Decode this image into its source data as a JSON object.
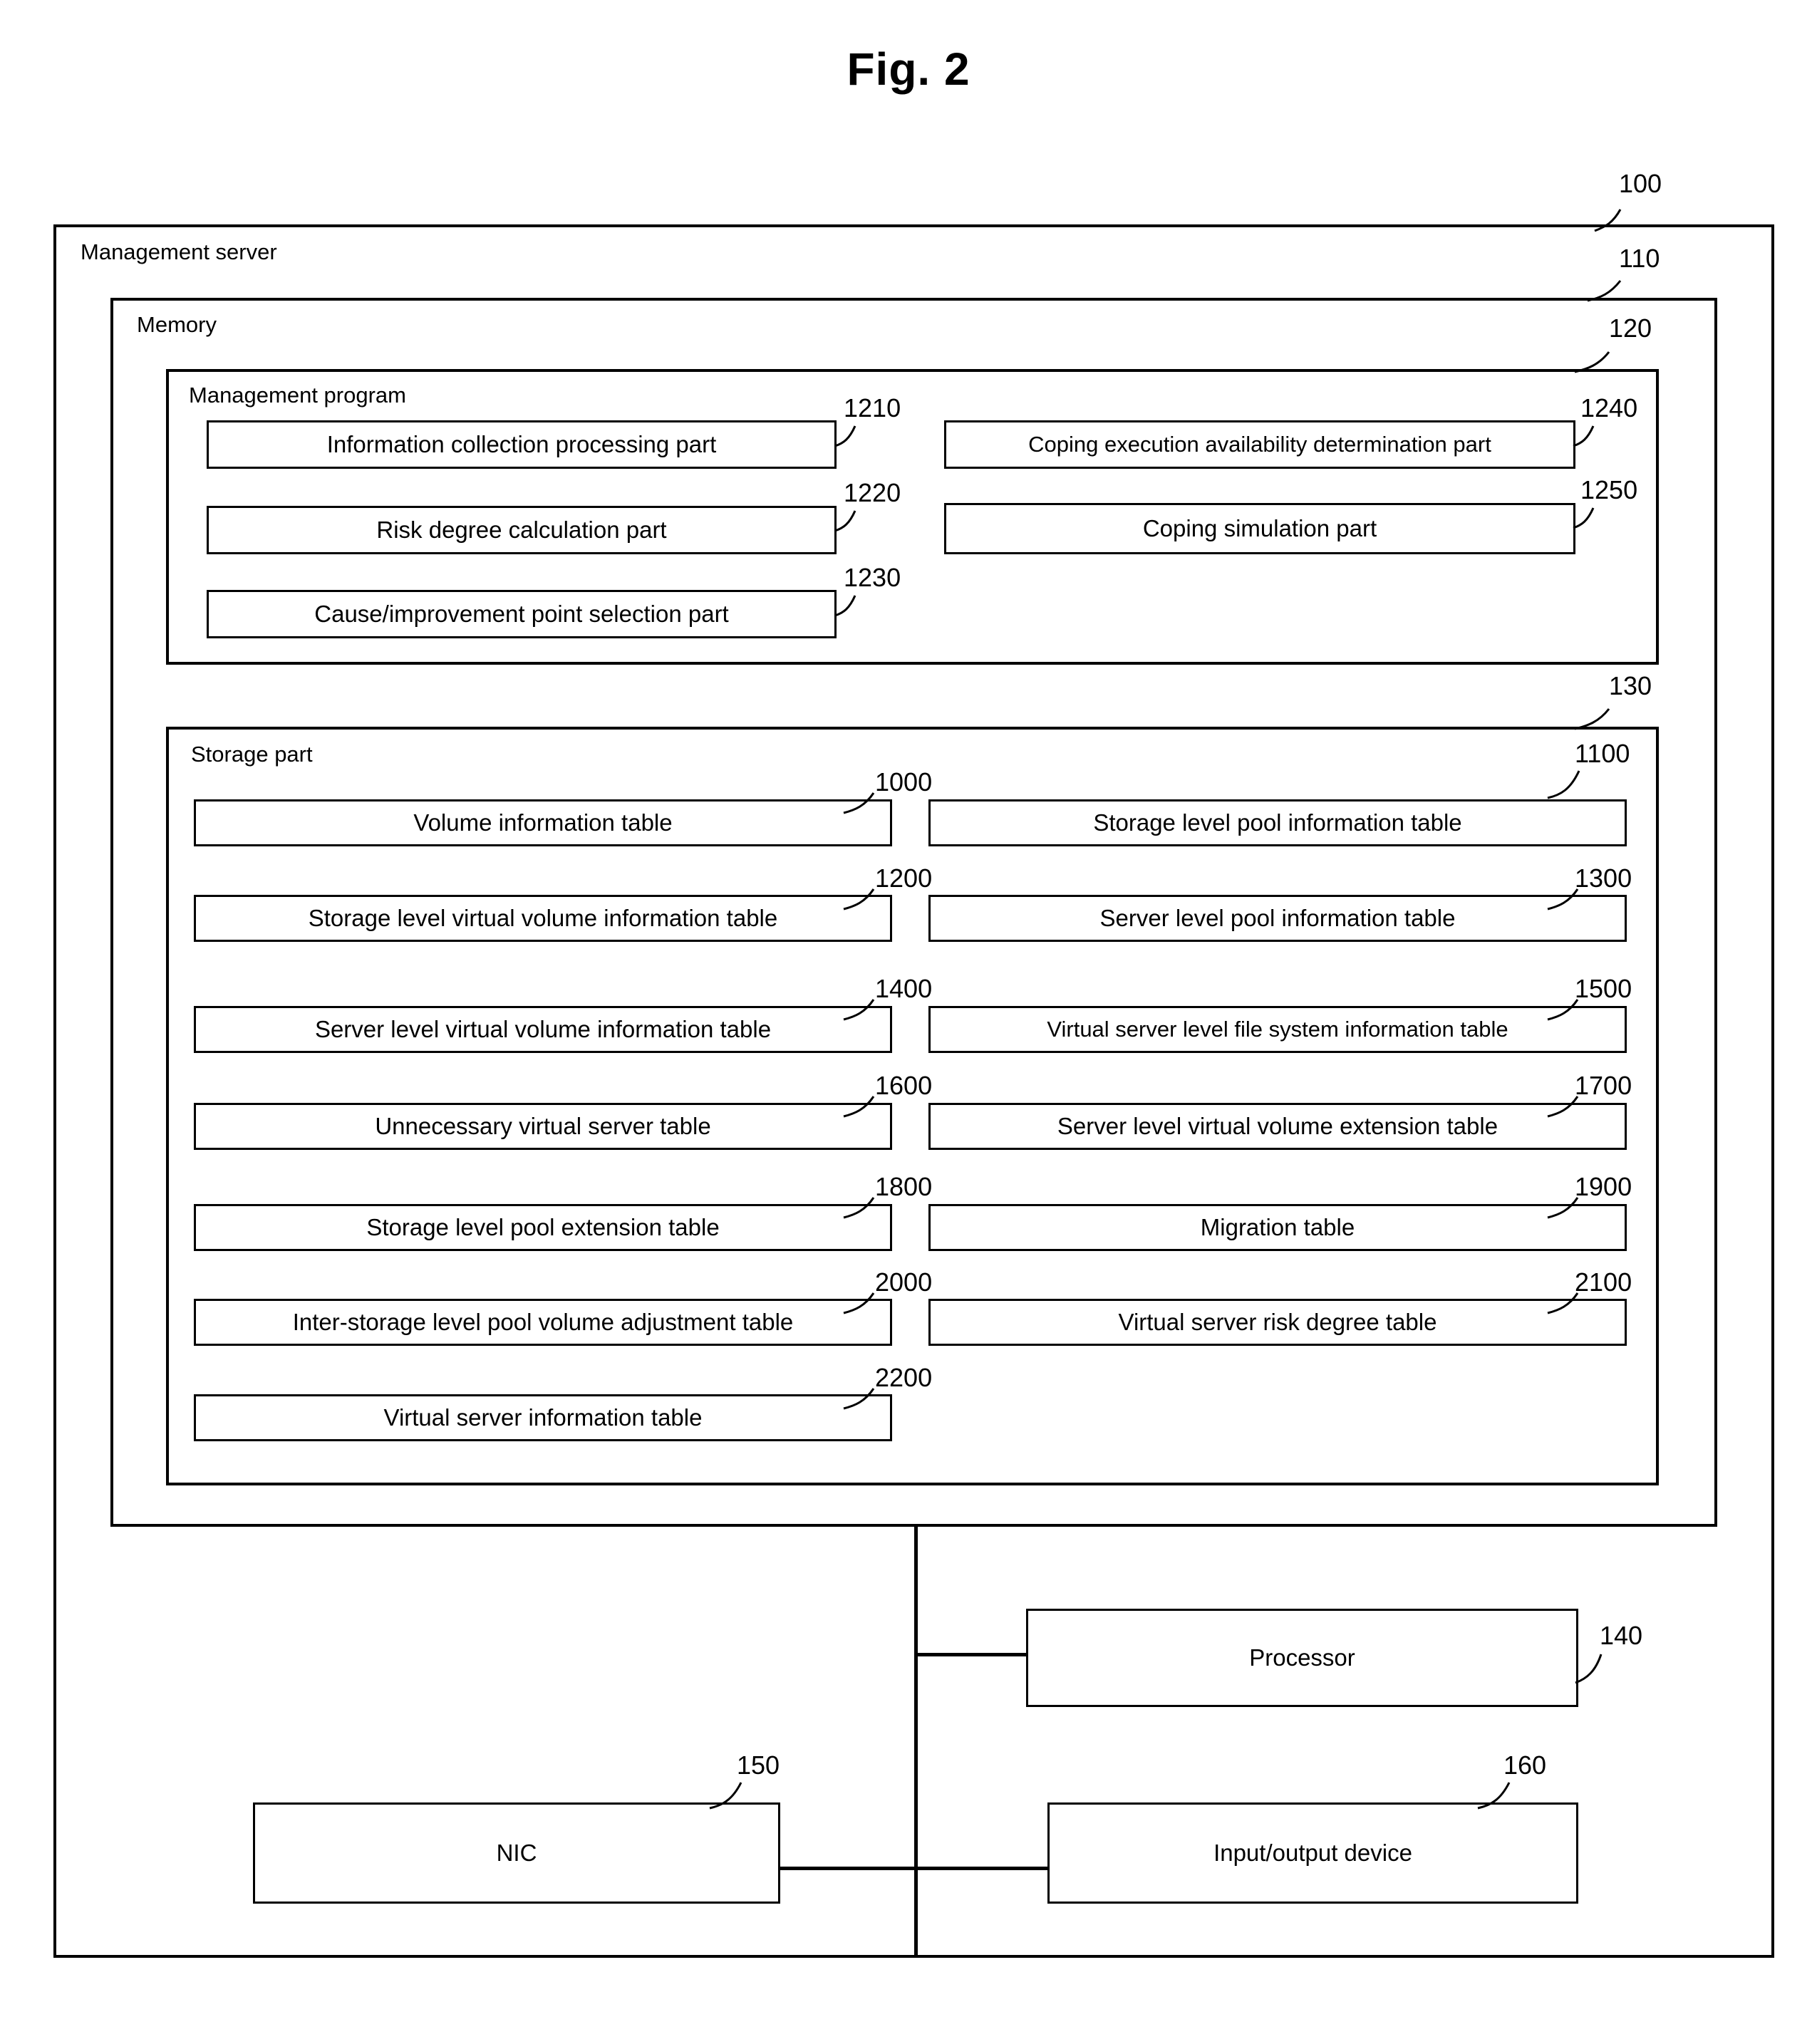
{
  "figure": {
    "title": "Fig. 2"
  },
  "outer": {
    "label": "Management server",
    "ref": "100"
  },
  "memory": {
    "label": "Memory",
    "ref": "110"
  },
  "management_program": {
    "label": "Management program",
    "ref": "120",
    "left_items": [
      {
        "label": "Information collection processing part",
        "ref": "1210"
      },
      {
        "label": "Risk degree calculation part",
        "ref": "1220"
      },
      {
        "label": "Cause/improvement point selection part",
        "ref": "1230"
      }
    ],
    "right_items": [
      {
        "label": "Coping execution availability determination part",
        "ref": "1240"
      },
      {
        "label": "Coping simulation part",
        "ref": "1250"
      }
    ]
  },
  "storage_part": {
    "label": "Storage part",
    "ref": "130",
    "left_items": [
      {
        "label": "Volume information table",
        "ref": "1000"
      },
      {
        "label": "Storage level virtual volume information table",
        "ref": "1200"
      },
      {
        "label": "Server level virtual volume information table",
        "ref": "1400"
      },
      {
        "label": "Unnecessary virtual server table",
        "ref": "1600"
      },
      {
        "label": "Storage level pool extension table",
        "ref": "1800"
      },
      {
        "label": "Inter-storage level pool volume adjustment table",
        "ref": "2000"
      },
      {
        "label": "Virtual server information table",
        "ref": "2200"
      }
    ],
    "right_items": [
      {
        "label": "Storage level pool information table",
        "ref": "1100"
      },
      {
        "label": "Server level pool information table",
        "ref": "1300"
      },
      {
        "label": "Virtual server level file system information table",
        "ref": "1500"
      },
      {
        "label": "Server level virtual volume extension table",
        "ref": "1700"
      },
      {
        "label": "Migration table",
        "ref": "1900"
      },
      {
        "label": "Virtual server risk degree table",
        "ref": "2100"
      }
    ]
  },
  "hardware": {
    "processor": {
      "label": "Processor",
      "ref": "140"
    },
    "nic": {
      "label": "NIC",
      "ref": "150"
    },
    "io_device": {
      "label": "Input/output device",
      "ref": "160"
    }
  }
}
